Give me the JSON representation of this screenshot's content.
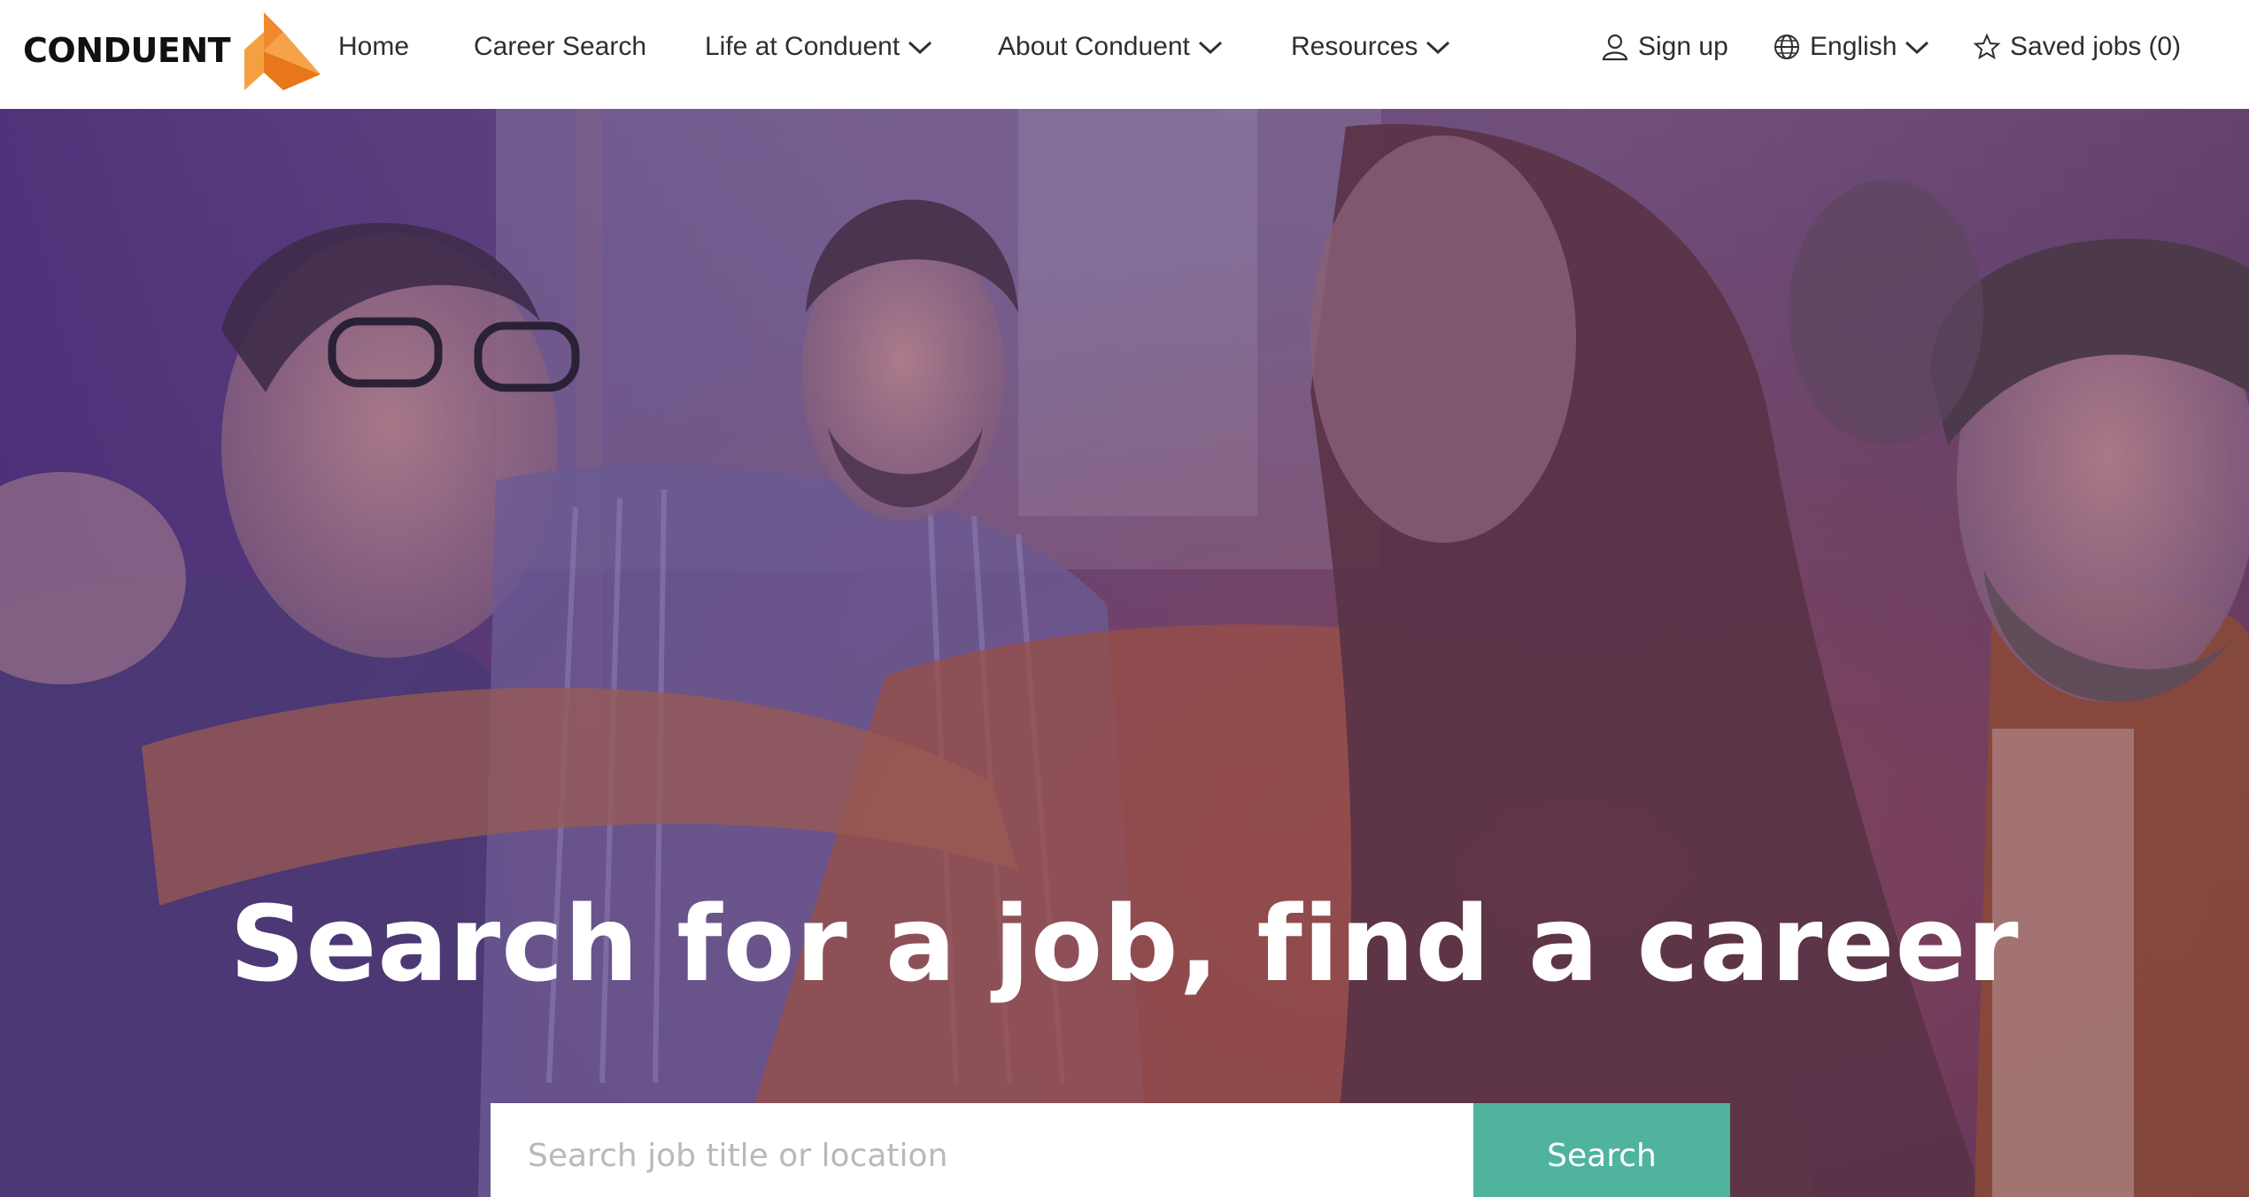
{
  "brand": {
    "name": "CONDUENT",
    "accent_color": "#f18a2a"
  },
  "nav": {
    "home": "Home",
    "career_search": "Career Search",
    "life_at": "Life at Conduent",
    "about": "About Conduent",
    "resources": "Resources"
  },
  "utility": {
    "sign_up": "Sign up",
    "language": "English",
    "saved_jobs": "Saved jobs",
    "saved_count": "(0)"
  },
  "hero": {
    "title": "Search for a job, find a career",
    "search_placeholder": "Search job title or location",
    "search_button": "Search",
    "button_color": "#4fb39e"
  }
}
